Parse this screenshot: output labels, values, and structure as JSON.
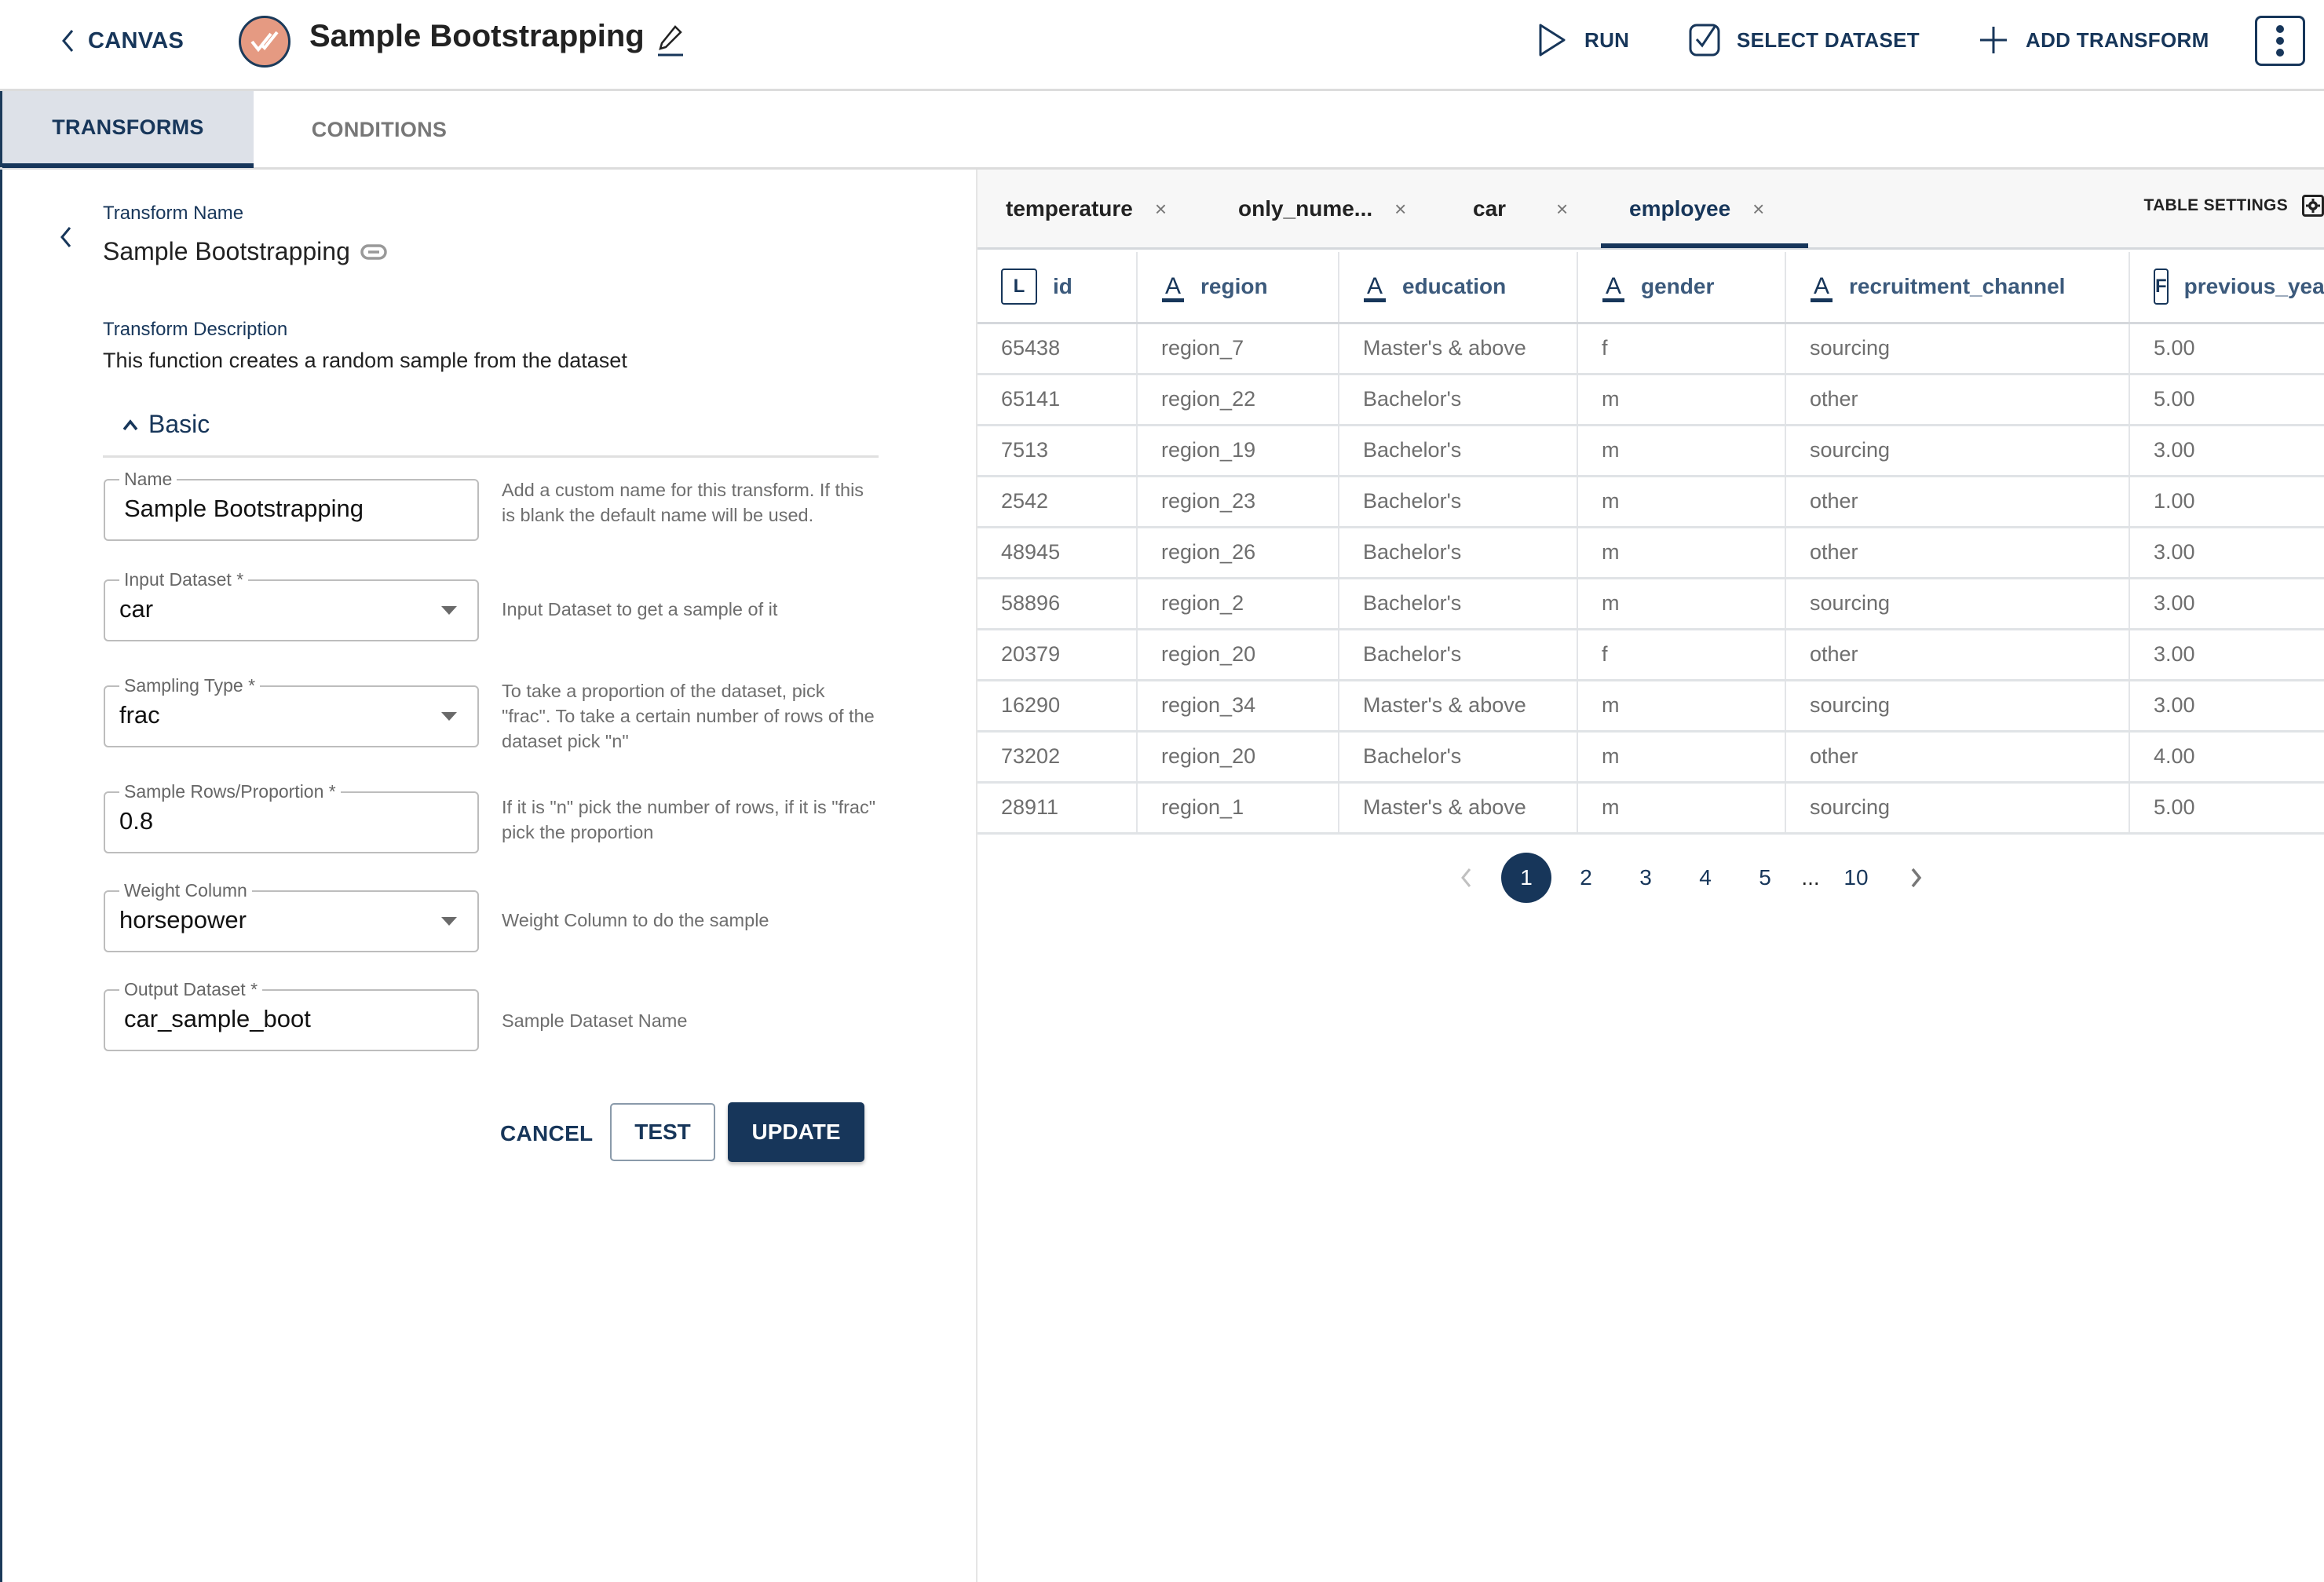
{
  "header": {
    "back_label": "CANVAS",
    "title": "Sample Bootstrapping",
    "actions": {
      "run": "RUN",
      "select_dataset": "SELECT DATASET",
      "add_transform": "ADD TRANSFORM"
    },
    "logo_color": "#e59a82",
    "brand_color": "#17365a"
  },
  "tabs": {
    "transforms": "TRANSFORMS",
    "conditions": "CONDITIONS",
    "active": "TRANSFORMS"
  },
  "transform": {
    "name_label": "Transform Name",
    "name": "Sample Bootstrapping",
    "description_label": "Transform Description",
    "description": "This function creates a random sample from the dataset",
    "section": "Basic",
    "fields": [
      {
        "label": "Name",
        "value": "Sample Bootstrapping",
        "help": "Add a custom name for this transform. If this is blank the default name will be used."
      },
      {
        "label": "Input Dataset *",
        "value": "car",
        "help": "Input Dataset to get a sample of it"
      },
      {
        "label": "Sampling Type *",
        "value": "frac",
        "help": "To take a proportion of the dataset, pick \"frac\". To take a certain number of rows of the dataset pick \"n\""
      },
      {
        "label": "Sample Rows/Proportion *",
        "value": "0.8",
        "help": "If it is \"n\" pick the number of rows, if it is \"frac\" pick the proportion"
      },
      {
        "label": "Weight Column",
        "value": "horsepower",
        "help": "Weight Column to do the sample"
      },
      {
        "label": "Output Dataset *",
        "value": "car_sample_boot",
        "help": "Sample Dataset Name"
      }
    ],
    "buttons": {
      "cancel": "CANCEL",
      "test": "TEST",
      "update": "UPDATE"
    }
  },
  "datasets": {
    "tabs": [
      {
        "label": "temperature",
        "close": "×"
      },
      {
        "label": "only_nume...",
        "close": "×"
      },
      {
        "label": "car",
        "close": "×"
      },
      {
        "label": "employee",
        "close": "×"
      }
    ],
    "active_tab": "employee",
    "table_settings": "TABLE SETTINGS",
    "columns": [
      {
        "type": "L",
        "name": "id"
      },
      {
        "type": "A",
        "name": "region"
      },
      {
        "type": "A",
        "name": "education"
      },
      {
        "type": "A",
        "name": "gender"
      },
      {
        "type": "A",
        "name": "recruitment_channel"
      },
      {
        "type": "F",
        "name": "previous_year_rating"
      }
    ],
    "rows": [
      [
        "65438",
        "region_7",
        "Master's & above",
        "f",
        "sourcing",
        "5.00"
      ],
      [
        "65141",
        "region_22",
        "Bachelor's",
        "m",
        "other",
        "5.00"
      ],
      [
        "7513",
        "region_19",
        "Bachelor's",
        "m",
        "sourcing",
        "3.00"
      ],
      [
        "2542",
        "region_23",
        "Bachelor's",
        "m",
        "other",
        "1.00"
      ],
      [
        "48945",
        "region_26",
        "Bachelor's",
        "m",
        "other",
        "3.00"
      ],
      [
        "58896",
        "region_2",
        "Bachelor's",
        "m",
        "sourcing",
        "3.00"
      ],
      [
        "20379",
        "region_20",
        "Bachelor's",
        "f",
        "other",
        "3.00"
      ],
      [
        "16290",
        "region_34",
        "Master's & above",
        "m",
        "sourcing",
        "3.00"
      ],
      [
        "73202",
        "region_20",
        "Bachelor's",
        "m",
        "other",
        "4.00"
      ],
      [
        "28911",
        "region_1",
        "Master's & above",
        "m",
        "sourcing",
        "5.00"
      ]
    ],
    "pagination": {
      "current": "1",
      "pages": [
        "1",
        "2",
        "3",
        "4",
        "5"
      ],
      "ellipsis": "...",
      "last": "10"
    }
  }
}
